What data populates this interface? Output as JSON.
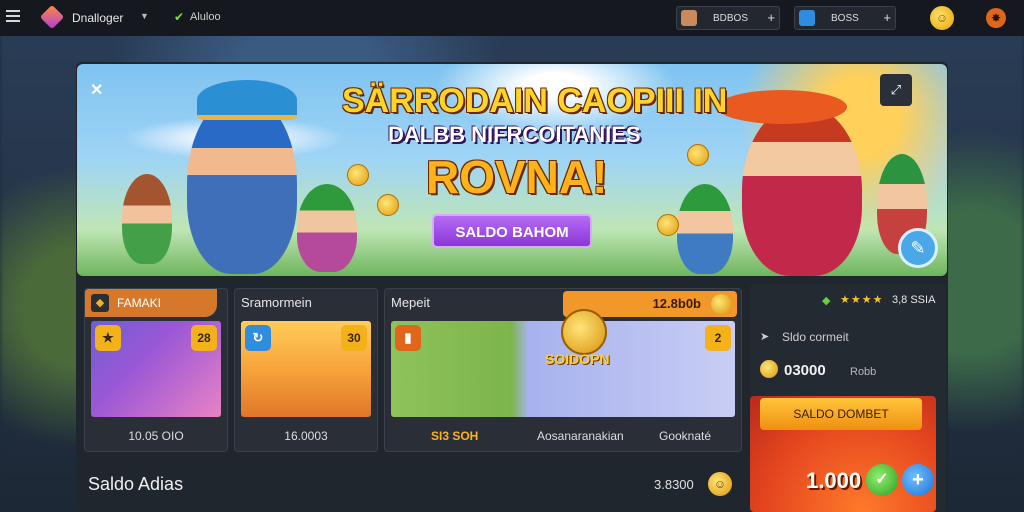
{
  "topbar": {
    "brand": "Dnalloger",
    "nav_label": "Aluloo",
    "chip1_text": "BDBOS",
    "chip2_text": "BOSS"
  },
  "banner": {
    "headline_1": "SÄRRODAIN CAOPIII IN",
    "headline_2": "DALBB NIFRCOITANIES",
    "headline_3": "ROVNA!",
    "cta": "SALDO BAHOM"
  },
  "cards": {
    "c1": {
      "title": "FAMAKI",
      "caption": "10.05 OIO",
      "badge_r": "28"
    },
    "c2": {
      "title": "Sramormein",
      "caption": "16.0003",
      "badge_r": "30"
    },
    "c3": {
      "title": "Mepeit",
      "tag_value": "12.8b0b",
      "badge_r": "2",
      "coin_word": "SOIDOPN",
      "caption_left": "SI3 SOH",
      "caption_mid": "Aosanaranakian",
      "caption_right": "Gooknaté"
    }
  },
  "side": {
    "rating": "3,8 SSIA",
    "link_text": "Sldo cormeit",
    "balance": "03000",
    "balance_unit": "Robb",
    "promo_cta": "SALDO DOMBET",
    "promo_value": "1.000"
  },
  "bottom": {
    "title": "Saldo Adias",
    "value": "3.8300"
  },
  "colors": {
    "accent_orange": "#f2972a",
    "accent_purple": "#8a36d6",
    "coin_gold": "#f3b21a"
  }
}
